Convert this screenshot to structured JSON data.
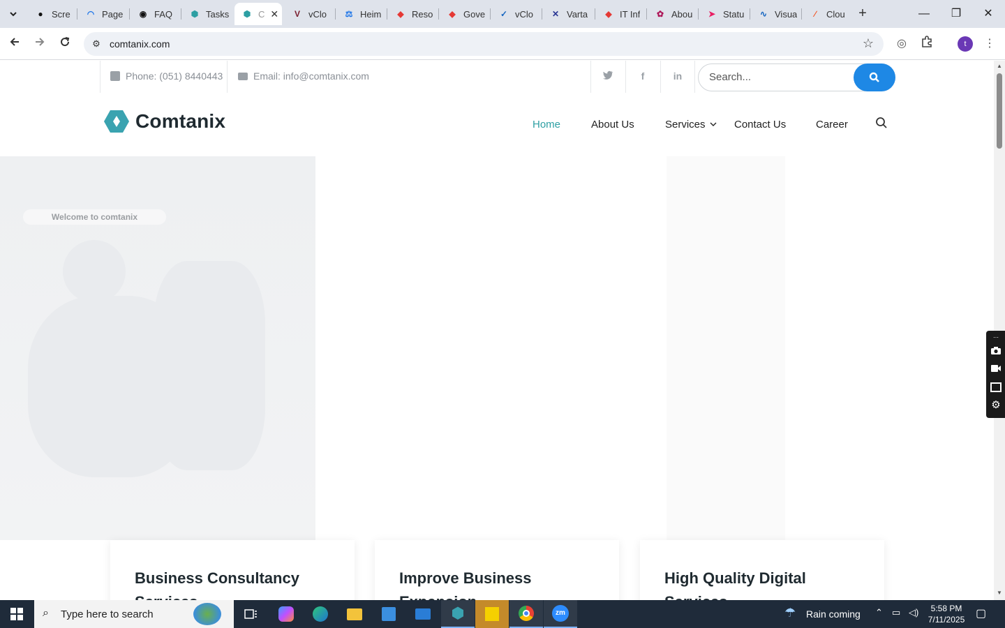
{
  "browser": {
    "tabs": [
      {
        "label": "Scre",
        "icon": "github-icon"
      },
      {
        "label": "Page",
        "icon": "wifi-icon"
      },
      {
        "label": "FAQ",
        "icon": "faq-icon"
      },
      {
        "label": "Tasks",
        "icon": "tasks-icon"
      },
      {
        "label": "C",
        "icon": "comtanix-icon",
        "active": true
      },
      {
        "label": "vClo",
        "icon": "v-icon"
      },
      {
        "label": "Heim",
        "icon": "scale-icon"
      },
      {
        "label": "Reso",
        "icon": "diamond-icon"
      },
      {
        "label": "Gove",
        "icon": "diamond-icon"
      },
      {
        "label": "vClo",
        "icon": "check-icon"
      },
      {
        "label": "Varta",
        "icon": "x-icon"
      },
      {
        "label": "IT Inf",
        "icon": "diamond-icon"
      },
      {
        "label": "Abou",
        "icon": "petal-icon"
      },
      {
        "label": "Statu",
        "icon": "arrow-icon"
      },
      {
        "label": "Visua",
        "icon": "pulse-icon"
      },
      {
        "label": "Clou",
        "icon": "slash-icon"
      }
    ],
    "url": "comtanix.com"
  },
  "topbar": {
    "phone": "Phone: (051) 8440443",
    "email": "Email: info@comtanix.com",
    "search_placeholder": "Search..."
  },
  "header": {
    "logo_text": "Comtanix",
    "nav": [
      "Home",
      "About Us",
      "Services",
      "Contact Us",
      "Career"
    ]
  },
  "hero": {
    "tagline": "Welcome to comtanix"
  },
  "cards": [
    {
      "title": "Business Consultancy Services"
    },
    {
      "title": "Improve Business Expansion"
    },
    {
      "title": "High Quality Digital Services"
    }
  ],
  "taskbar": {
    "search_text": "Type here to search",
    "weather": "Rain coming",
    "time": "5:58 PM",
    "date": "7/11/2025"
  },
  "colors": {
    "accent": "#2d9fa3",
    "search_button": "#1e88e5",
    "text_dark": "#1f2a30"
  }
}
